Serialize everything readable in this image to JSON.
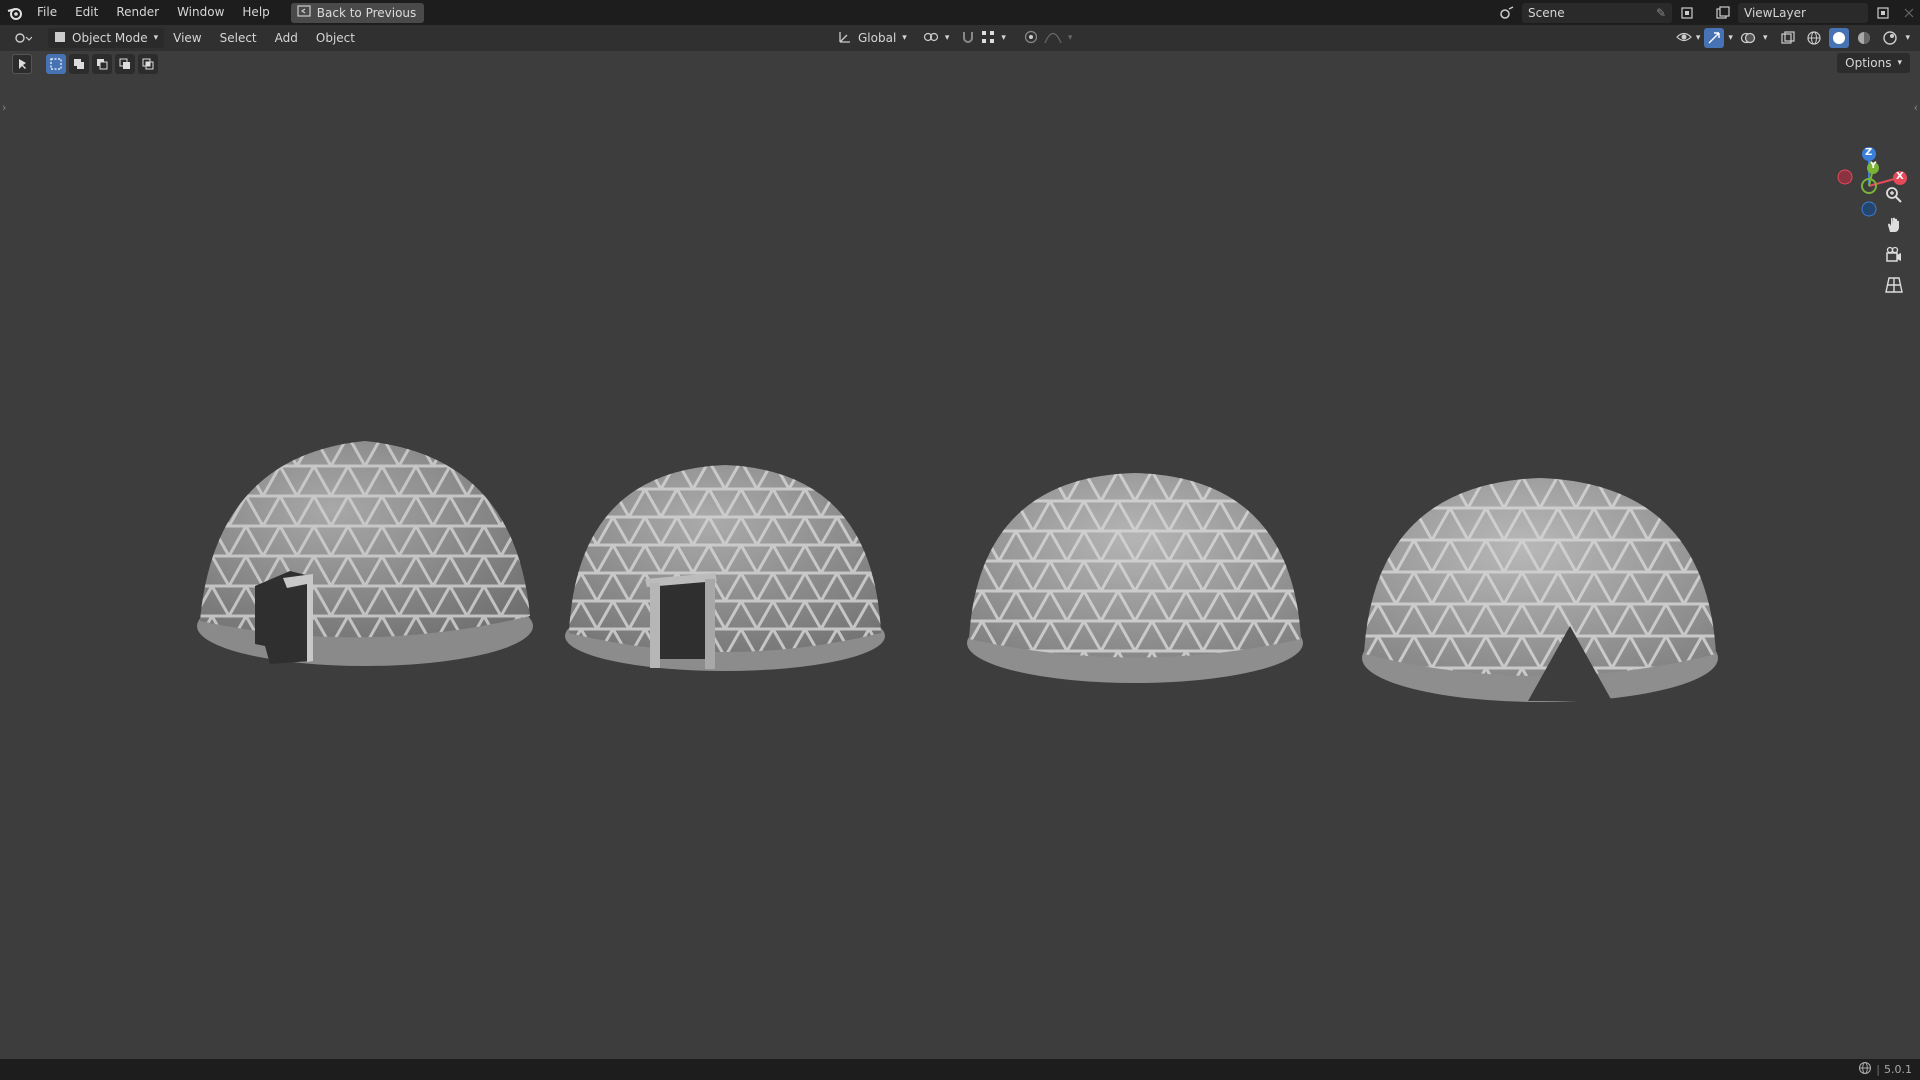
{
  "topbar": {
    "menus": [
      "File",
      "Edit",
      "Render",
      "Window",
      "Help"
    ],
    "back_button": "Back to Previous",
    "scene_name": "Scene",
    "view_layer": "ViewLayer"
  },
  "header": {
    "mode": "Object Mode",
    "menus": [
      "View",
      "Select",
      "Add",
      "Object"
    ],
    "orientation": "Global",
    "options_label": "Options"
  },
  "gizmo": {
    "x_label": "X",
    "y_label": "Y",
    "z_label": "Z"
  },
  "status": {
    "version": "5.0.1"
  },
  "colors": {
    "viewport_bg": "#3d3d3d",
    "dome_fill": "#9e9e9e",
    "accent": "#4772b3",
    "x_axis": "#e64a5a",
    "y_axis": "#7bb336",
    "z_axis": "#3a7fd9"
  }
}
